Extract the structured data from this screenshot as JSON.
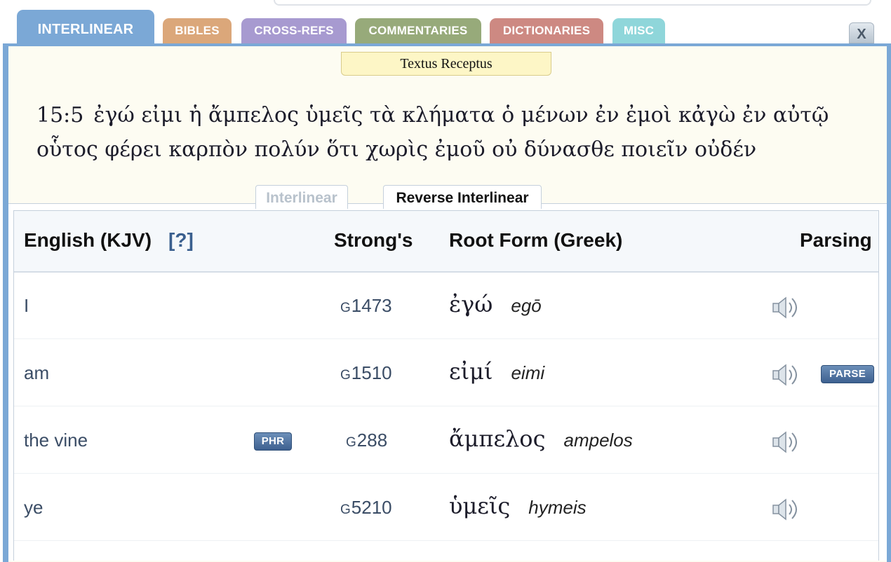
{
  "tabs": {
    "interlinear": "INTERLINEAR",
    "bibles": "BIBLES",
    "cross_refs": "CROSS-REFS",
    "commentaries": "COMMENTARIES",
    "dictionaries": "DICTIONARIES",
    "misc": "MISC"
  },
  "tab_colors": {
    "interlinear": "#7ba8d6",
    "bibles": "#dba77a",
    "cross_refs": "#a79ad0",
    "commentaries": "#97aa7a",
    "dictionaries": "#cd8982",
    "misc": "#8fd6da"
  },
  "close_label": "X",
  "version_label": "Textus Receptus",
  "verse": {
    "ref": "15:5",
    "line1": "ἐγώ εἰμι ἡ ἄμπελος ὑμεῖς τὰ κλήματα ὁ μένων ἐν ἐμοὶ κἀγὼ ἐν αὐτῷ",
    "line2": "οὗτος φέρει καρπὸν πολύν ὅτι χωρὶς ἐμοῦ οὐ δύνασθε ποιεῖν οὐδέν"
  },
  "subtabs": {
    "interlinear": "Interlinear",
    "reverse": "Reverse Interlinear"
  },
  "table": {
    "headers": {
      "english": "English (KJV)",
      "help": "[?]",
      "strongs": "Strong's",
      "root": "Root Form (Greek)",
      "parsing": "Parsing"
    },
    "rows": [
      {
        "english": "I",
        "g": "G",
        "strongs": "1473",
        "greek": "ἐγώ",
        "translit": "egō",
        "phr": "",
        "parse": ""
      },
      {
        "english": "am",
        "g": "G",
        "strongs": "1510",
        "greek": "εἰμί",
        "translit": "eimi",
        "phr": "",
        "parse": "PARSE"
      },
      {
        "english": "the vine",
        "g": "G",
        "strongs": "288",
        "greek": "ἄμπελος",
        "translit": "ampelos",
        "phr": "PHR",
        "parse": ""
      },
      {
        "english": "ye",
        "g": "G",
        "strongs": "5210",
        "greek": "ὑμεῖς",
        "translit": "hymeis",
        "phr": "",
        "parse": ""
      }
    ]
  },
  "icons": {
    "audio": "speaker-icon",
    "close": "close-icon"
  }
}
